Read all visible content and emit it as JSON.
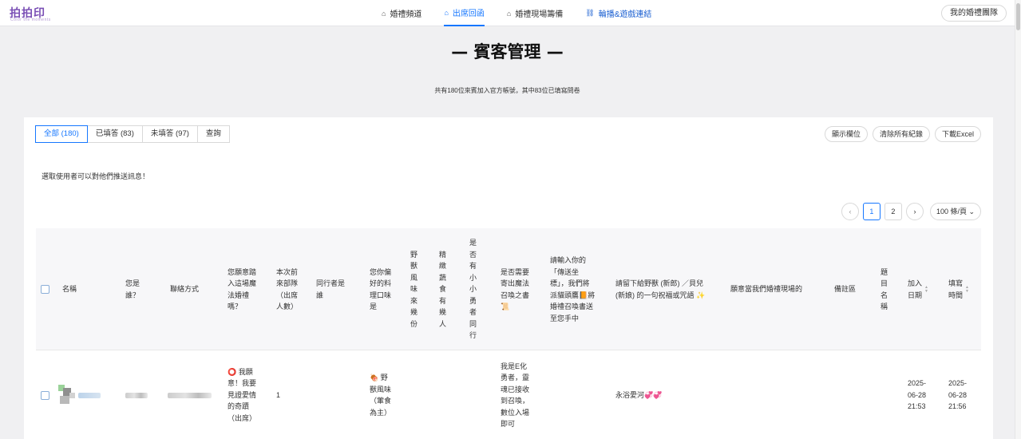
{
  "brand": {
    "logo": "拍拍印",
    "sub": "Color the moments"
  },
  "nav": [
    {
      "icon": "⌂",
      "label": "婚禮頻道"
    },
    {
      "icon": "⌂",
      "label": "出席回函"
    },
    {
      "icon": "⌂",
      "label": "婚禮現場籌備"
    },
    {
      "icon": "🔗",
      "label": "輪播&遊戲連結"
    }
  ],
  "team_button": "我的婚禮團隊",
  "page_title": "— 賓客管理 —",
  "summary": "共有180位來賓加入官方帳號，其中83位已填寫問卷",
  "tabs": [
    "全部 (180)",
    "已填答 (83)",
    "未填答 (97)",
    "查詢"
  ],
  "actions": [
    "顯示欄位",
    "清除所有紀錄",
    "下載Excel"
  ],
  "hint": "選取使用者可以對他們推送訊息！",
  "pagination": {
    "prev": "‹",
    "pages": [
      "1",
      "2"
    ],
    "next": "›",
    "page_size": "100 條/頁 ⌄"
  },
  "columns": {
    "name": "名稱",
    "who": "您是\n誰？",
    "contact": "聯絡方式",
    "attend": "您願意踏\n入這場魔\n法婚禮\n嗎？",
    "party": "本次前\n來部隊\n（出席\n人數）",
    "companion": "同行者是\n誰",
    "taste": "您你偏\n好的料\n理口味\n是",
    "beast": "野\n獸\n風\n味\n來\n幾\n份",
    "veg": "精\n緻\n蔬\n食\n有\n幾\n人",
    "kids": "是\n否\n有\n小\n小\n勇\n者\n同\n行",
    "mail": "是否需要\n寄出魔法\n召喚之書\n📜",
    "address": "請輸入你的\n「傳送坐\n標」，我們將\n派貓頭鷹📙將\n婚禮召喚書送\n至您手中",
    "blessing": "請留下給野獸 (新郎) ／貝兒\n(新娘) 的一句祝福或咒語 ✨",
    "volunteer": "願意當我們婚禮現場的",
    "note": "備註區",
    "title": "題\n目\n名\n稱",
    "joined": "加入\n日期",
    "filled": "填寫\n時間"
  },
  "rows": [
    {
      "attend": "⭕ 我願\n意！我要\n見證愛情\n的奇蹟\n（出席）",
      "party": "1",
      "taste": "🍖 野\n獸風味\n（葷食\n為主）",
      "mail": "我是E化\n勇者，靈\n魂已接收\n到召喚，\n數位入場\n即可",
      "blessing": "永浴愛河💞💞",
      "joined": "2025-\n06-28\n21:53",
      "filled": "2025-\n06-28\n21:56"
    }
  ]
}
